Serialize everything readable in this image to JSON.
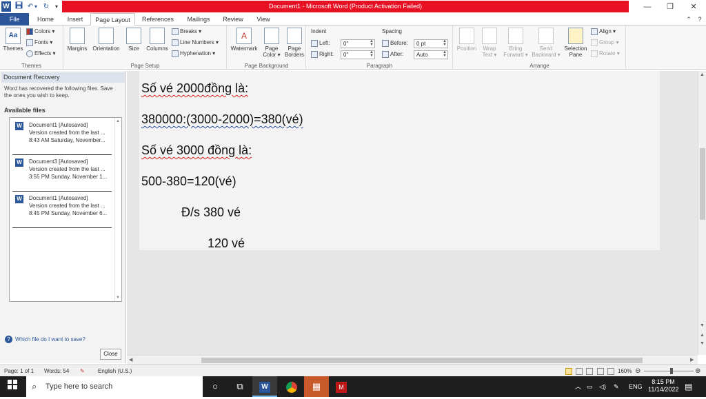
{
  "window": {
    "title": "Document1 - Microsoft Word (Product Activation Failed)",
    "help": "?",
    "minimize": "—",
    "restore": "❒",
    "close": "✕"
  },
  "quick_access": {
    "app_icon": "W",
    "save": "💾",
    "undo": "↶",
    "undo_drop": "▾",
    "redo": "↻",
    "customize": "▾"
  },
  "tabs": [
    "File",
    "Home",
    "Insert",
    "Page Layout",
    "References",
    "Mailings",
    "Review",
    "View"
  ],
  "ribbon": {
    "themes": {
      "group_label": "Themes",
      "themes": "Themes",
      "colors": "Colors ▾",
      "fonts": "Fonts ▾",
      "effects": "Effects ▾"
    },
    "page_setup": {
      "group_label": "Page Setup",
      "margins": "Margins",
      "orientation": "Orientation",
      "size": "Size",
      "columns": "Columns",
      "breaks": "Breaks ▾",
      "line_numbers": "Line Numbers ▾",
      "hyphenation": "Hyphenation ▾"
    },
    "page_background": {
      "group_label": "Page Background",
      "watermark": "Watermark",
      "page_color": "Page Color ▾",
      "page_borders": "Page Borders"
    },
    "paragraph": {
      "group_label": "Paragraph",
      "indent_label": "Indent",
      "left_label": "Left:",
      "left_value": "0\"",
      "right_label": "Right:",
      "right_value": "0\"",
      "spacing_label": "Spacing",
      "before_label": "Before:",
      "before_value": "0 pt",
      "after_label": "After:",
      "after_value": "Auto"
    },
    "arrange": {
      "group_label": "Arrange",
      "position": "Position",
      "wrap_text": "Wrap Text ▾",
      "bring_forward": "Bring Forward ▾",
      "send_backward": "Send Backward ▾",
      "selection_pane": "Selection Pane",
      "align": "Align ▾",
      "group": "Group ▾",
      "rotate": "Rotate ▾"
    },
    "collapse": "⌃"
  },
  "recovery": {
    "title": "Document Recovery",
    "description": "Word has recovered the following files.  Save the ones you wish to keep.",
    "available": "Available files",
    "files": [
      {
        "name": "Document1  [Autosaved]",
        "line2": "Version created from the last ...",
        "line3": "8:43 AM Saturday, November..."
      },
      {
        "name": "Document3  [Autosaved]",
        "line2": "Version created from the last ...",
        "line3": "3:55 PM Sunday, November 1..."
      },
      {
        "name": "Document1  [Autosaved]",
        "line2": "Version created from the last ...",
        "line3": "8:45 PM Sunday, November 6..."
      }
    ],
    "help_link": "Which file do I want to save?",
    "close": "Close"
  },
  "document": {
    "lines": [
      "Số vé 2000đồng là:",
      "380000:(3000-2000)=380(vé)",
      "Số vé 3000 đồng là:",
      "500-380=120(vé)",
      "Đ/s 380 vé",
      "120 vé"
    ]
  },
  "status": {
    "page": "Page: 1 of 1",
    "words": "Words: 54",
    "language": "English (U.S.)",
    "zoom": "160%"
  },
  "taskbar": {
    "search_placeholder": "Type here to search",
    "language": "ENG",
    "time": "8:15 PM",
    "date": "11/14/2022"
  }
}
